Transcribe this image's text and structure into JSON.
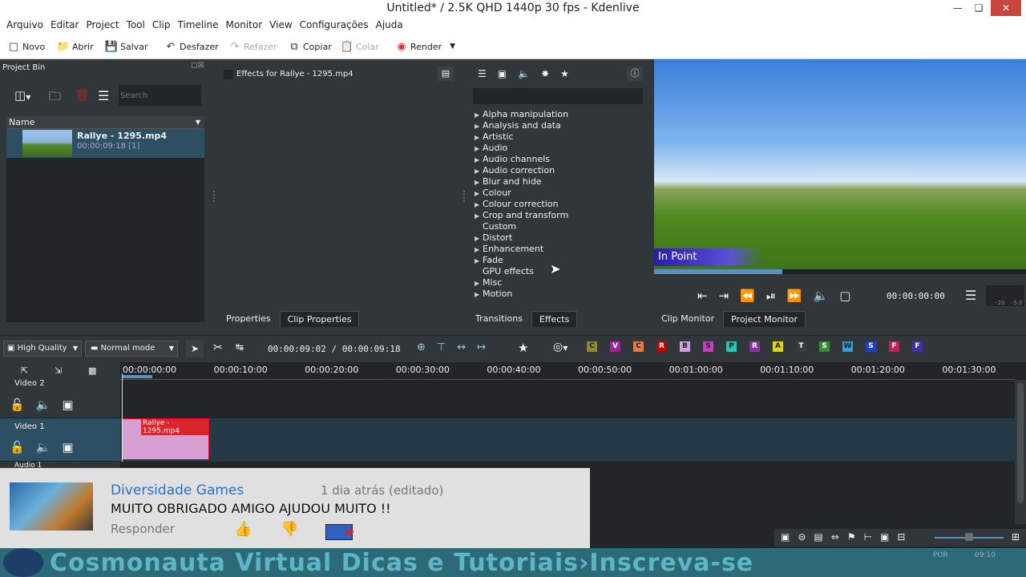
{
  "window": {
    "title": "Untitled* / 2.5K QHD 1440p 30 fps - Kdenlive"
  },
  "menu": [
    "Arquivo",
    "Editar",
    "Project",
    "Tool",
    "Clip",
    "Timeline",
    "Monitor",
    "View",
    "Configurações",
    "Ajuda"
  ],
  "toolbar": {
    "novo": "Novo",
    "abrir": "Abrir",
    "salvar": "Salvar",
    "desfazer": "Desfazer",
    "refazer": "Refazer",
    "copiar": "Copiar",
    "colar": "Colar",
    "render": "Render"
  },
  "bin": {
    "title": "Project Bin",
    "search_placeholder": "Search",
    "column": "Name",
    "clip_name": "Rallye - 1295.mp4",
    "clip_info": "00:00:09:18  [1]"
  },
  "effect_stack": {
    "title": "Effects for Rallye - 1295.mp4"
  },
  "effects": {
    "categories": [
      {
        "label": "Alpha manipulation",
        "arrow": true
      },
      {
        "label": "Analysis and data",
        "arrow": true
      },
      {
        "label": "Artistic",
        "arrow": true
      },
      {
        "label": "Audio",
        "arrow": true
      },
      {
        "label": "Audio channels",
        "arrow": true
      },
      {
        "label": "Audio correction",
        "arrow": true
      },
      {
        "label": "Blur and hide",
        "arrow": true
      },
      {
        "label": "Colour",
        "arrow": true
      },
      {
        "label": "Colour correction",
        "arrow": true
      },
      {
        "label": "Crop and transform",
        "arrow": true
      },
      {
        "label": "Custom",
        "arrow": false
      },
      {
        "label": "Distort",
        "arrow": true
      },
      {
        "label": "Enhancement",
        "arrow": true
      },
      {
        "label": "Fade",
        "arrow": true
      },
      {
        "label": "GPU effects",
        "arrow": false
      },
      {
        "label": "Misc",
        "arrow": true
      },
      {
        "label": "Motion",
        "arrow": true
      }
    ]
  },
  "tabs": {
    "properties": "Properties",
    "clip_properties": "Clip Properties",
    "transitions": "Transitions",
    "effects": "Effects",
    "clip_monitor": "Clip Monitor",
    "project_monitor": "Project Monitor"
  },
  "monitor": {
    "in_point": "In Point",
    "timecode": "00:00:00:00",
    "scale_a": "-20",
    "scale_b": "-5.0"
  },
  "timeline_toolbar": {
    "quality": "High Quality",
    "mode": "Normal mode",
    "position": "00:00:09:02",
    "duration": "00:00:09:18"
  },
  "ruler": [
    "00:00:00:00",
    "00:00:10:00",
    "00:00:20:00",
    "00:00:30:00",
    "00:00:40:00",
    "00:00:50:00",
    "00:01:00:00",
    "00:01:10:00",
    "00:01:20:00",
    "00:01:30:00"
  ],
  "tracks": {
    "video2": "Video 2",
    "video1": "Video 1",
    "audio1": "Audio 1",
    "clip_label": "Rallye - 1295.mp4"
  },
  "color_chips": [
    "C",
    "V",
    "C",
    "R",
    "B",
    "S",
    "P",
    "R",
    "A",
    "T",
    "S",
    "W",
    "S",
    "F",
    "F"
  ],
  "comment": {
    "author": "Diversidade Games",
    "time": "1 dia atrás (editado)",
    "text": "MUITO OBRIGADO AMIGO AJUDOU MUITO !!",
    "reply": "Responder"
  },
  "banner": {
    "text": "Cosmonauta Virtual Dicas e Tutoriais›Inscreva-se"
  },
  "taskbar": {
    "lang": "POR",
    "clock": "09:10"
  }
}
